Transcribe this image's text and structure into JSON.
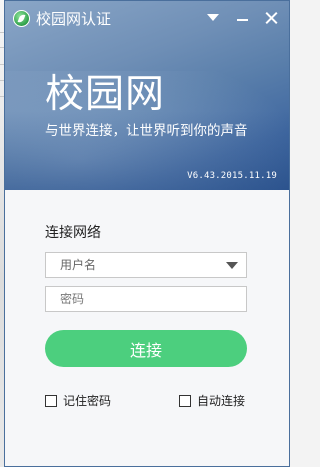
{
  "window": {
    "title": "校园网认证"
  },
  "banner": {
    "brand": "校园网",
    "slogan": "与世界连接，让世界听到你的声音",
    "version": "V6.43.2015.11.19"
  },
  "form": {
    "title": "连接网络",
    "username_placeholder": "用户名",
    "password_placeholder": "密码",
    "connect_label": "连接",
    "remember_label": "记住密码",
    "auto_connect_label": "自动连接",
    "remember_checked": false,
    "auto_connect_checked": false
  },
  "colors": {
    "banner": "#5a7fab",
    "connect_button": "#4ccf7e",
    "logo": "#2fa04a"
  },
  "icons": {
    "app": "leaf-logo-icon",
    "dropdown": "chevron-down-icon",
    "minimize": "minimize-icon",
    "close": "close-icon",
    "select_arrow": "caret-down-icon"
  }
}
